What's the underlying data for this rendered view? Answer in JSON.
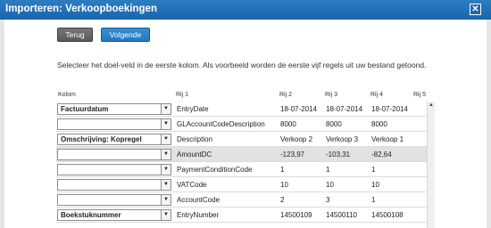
{
  "window": {
    "title": "Importeren: Verkoopboekingen",
    "close_glyph": "✕"
  },
  "buttons": {
    "back": "Terug",
    "next": "Volgende"
  },
  "instructions": "Selecteer het doel-veld in de eerste kolom. Als voorbeeld worden de eerste vijf regels uit uw bestand getoond.",
  "table": {
    "headers": [
      "Kolom",
      "Rij 1",
      "Rij 2",
      "Rij 3",
      "Rij 4",
      "Rij 5"
    ],
    "rows": [
      {
        "select": "Factuurdatum",
        "cells": [
          "EntryDate",
          "18-07-2014",
          "18-07-2014",
          "18-07-2014"
        ]
      },
      {
        "select": "",
        "cells": [
          "GLAccountCodeDescription",
          "8000",
          "8000",
          "8000"
        ]
      },
      {
        "select": "Omschrijving: Kopregel",
        "cells": [
          "Description",
          "Verkoop 2",
          "Verkoop 3",
          "Verkoop 1"
        ]
      },
      {
        "select": "",
        "cells": [
          "AmountDC",
          "-123,97",
          "-103,31",
          "-82,64"
        ]
      },
      {
        "select": "",
        "cells": [
          "PaymentConditionCode",
          "1",
          "1",
          "1"
        ]
      },
      {
        "select": "",
        "cells": [
          "VATCode",
          "10",
          "10",
          "10"
        ]
      },
      {
        "select": "",
        "cells": [
          "AccountCode",
          "2",
          "3",
          "1"
        ]
      },
      {
        "select": "Boekstuknummer",
        "cells": [
          "EntryNumber",
          "14500109",
          "14500110",
          "14500108"
        ]
      }
    ]
  },
  "icons": {
    "dropdown": "chevron-down-icon",
    "scroll_up": "scroll-up-icon"
  },
  "colors": {
    "titlebar": "#1f6db4",
    "accent_button": "#2d84cc",
    "shaded_row": "#e2e2e2"
  }
}
